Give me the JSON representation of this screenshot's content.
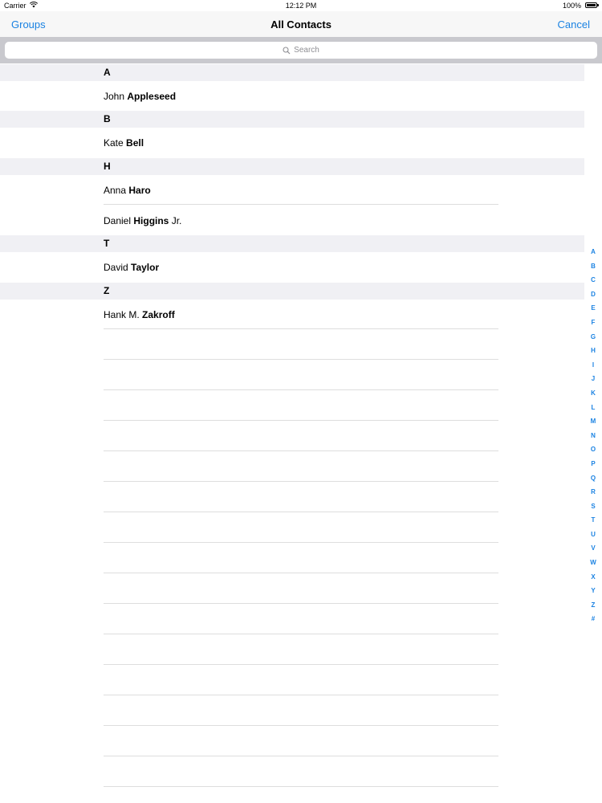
{
  "status_bar": {
    "carrier": "Carrier",
    "time": "12:12 PM",
    "battery": "100%"
  },
  "nav": {
    "left_button": "Groups",
    "title": "All Contacts",
    "right_button": "Cancel"
  },
  "search": {
    "placeholder": "Search"
  },
  "sections": [
    {
      "letter": "A",
      "contacts": [
        {
          "first": "John ",
          "last": "Appleseed",
          "suffix": ""
        }
      ]
    },
    {
      "letter": "B",
      "contacts": [
        {
          "first": "Kate ",
          "last": "Bell",
          "suffix": ""
        }
      ]
    },
    {
      "letter": "H",
      "contacts": [
        {
          "first": "Anna ",
          "last": "Haro",
          "suffix": ""
        },
        {
          "first": "Daniel ",
          "last": "Higgins",
          "suffix": " Jr."
        }
      ]
    },
    {
      "letter": "T",
      "contacts": [
        {
          "first": "David ",
          "last": "Taylor",
          "suffix": ""
        }
      ]
    },
    {
      "letter": "Z",
      "contacts": [
        {
          "first": "Hank M. ",
          "last": "Zakroff",
          "suffix": ""
        }
      ]
    }
  ],
  "index_letters": [
    "A",
    "B",
    "C",
    "D",
    "E",
    "F",
    "G",
    "H",
    "I",
    "J",
    "K",
    "L",
    "M",
    "N",
    "O",
    "P",
    "Q",
    "R",
    "S",
    "T",
    "U",
    "V",
    "W",
    "X",
    "Y",
    "Z",
    "#"
  ],
  "colors": {
    "accent": "#1a82e2",
    "section_bg": "#f0f0f4",
    "search_bar_bg": "#c9c9ce"
  }
}
